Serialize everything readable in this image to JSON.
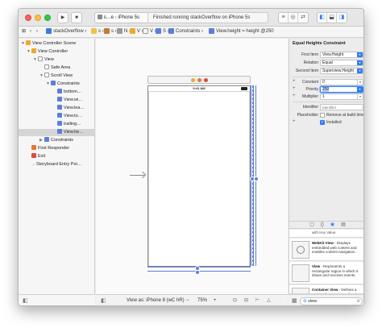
{
  "toolbar": {
    "scheme_label": "s…e",
    "device_label": "iPhone 5s",
    "activity_text": "Finished running stackOverflow on iPhone 5s"
  },
  "jumpbar": {
    "project": "stackOverflow",
    "crumb_1": "s",
    "crumb_2": "s",
    "crumb_3": "N",
    "crumb_4": "V",
    "crumb_5": "V",
    "crumb_6": "S",
    "crumb_7": "Constraints",
    "crumb_8": "View.height = height @250"
  },
  "navigator": {
    "items": [
      {
        "label": "View Controller Scene"
      },
      {
        "label": "View Controller"
      },
      {
        "label": "View"
      },
      {
        "label": "Safe Area"
      },
      {
        "label": "Scroll View"
      },
      {
        "label": "Constraints"
      },
      {
        "label": "bottom…"
      },
      {
        "label": "View.wi…"
      },
      {
        "label": "View.lea…"
      },
      {
        "label": "View.to…"
      },
      {
        "label": "trailing…"
      },
      {
        "label": "View.he…"
      },
      {
        "label": "Constraints"
      },
      {
        "label": "First Responder"
      },
      {
        "label": "Exit"
      },
      {
        "label": "Storyboard Entry Poi…"
      }
    ]
  },
  "canvas": {
    "status_time": "9:41 AM",
    "view_as": "View as: iPhone 8 (wC hR)",
    "zoom": "75%"
  },
  "inspector": {
    "title": "Equal Heights Constraint",
    "first_item_label": "First Item",
    "first_item_value": "View.Height",
    "relation_label": "Relation",
    "relation_value": "Equal",
    "second_item_label": "Second Item",
    "second_item_value": "Superview.Height",
    "constant_label": "Constant",
    "constant_value": "0",
    "priority_label": "Priority",
    "priority_value": "250",
    "multiplier_label": "Multiplier",
    "multiplier_value": "1",
    "identifier_label": "Identifier",
    "identifier_placeholder": "Identifier",
    "placeholder_label": "Placeholder",
    "placeholder_text": "Remove at build time",
    "installed_label": "Installed"
  },
  "library": {
    "items": [
      {
        "title": "",
        "desc": "with Key Value"
      },
      {
        "title": "WebKit View",
        "desc": " - Displays embedded web content and enables content navigation."
      },
      {
        "title": "View",
        "desc": " - Represents a rectangular region in which it draws and receives events."
      },
      {
        "title": "Container View",
        "desc": " - Defines a region of a view controller that can include a child view controller."
      }
    ],
    "filter_placeholder": "view"
  },
  "colors": {
    "accent": "#2f7cf6",
    "constraint": "#5b7fd6"
  }
}
